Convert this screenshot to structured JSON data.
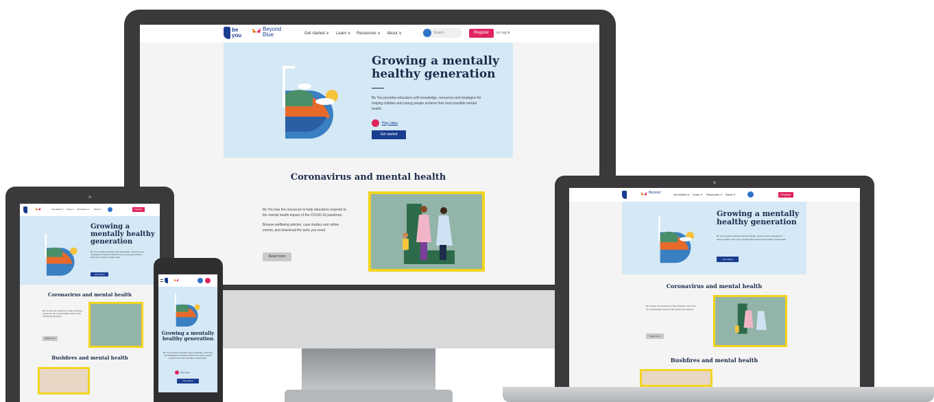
{
  "brand": {
    "be": "be",
    "you": "you",
    "beyond": "Beyond",
    "blue": "Blue",
    "b_letter": "b",
    "butterfly": "butterfly-icon"
  },
  "nav": {
    "items": [
      "Get started ∨",
      "Learn ∨",
      "Resources ∨",
      "About ∨"
    ],
    "search_placeholder": "Search",
    "register": "Register",
    "login": "Log in",
    "or": "or"
  },
  "hero": {
    "title": "Growing a mentally healthy generation",
    "title_l1": "Growing a mentally",
    "title_l2": "healthy generation",
    "title_tab_l1": "Growing a",
    "title_tab_l2": "mentally healthy",
    "title_tab_l3": "generation",
    "body": "Be You provides educators with knowledge, resources and strategies for helping children and young people achieve their best possible mental health.",
    "play_label": "Play video",
    "cta": "Get started"
  },
  "covid": {
    "title": "Coronavirus and mental health",
    "p1": "Be You has the resources to help educators respond to the mental health impact of the COVID-19 pandemic.",
    "p2": "Browse wellbeing articles, case studies and online events, and download the tools you need.",
    "cta": "Read more"
  },
  "bushfires": {
    "title": "Bushfires and mental health"
  },
  "colors": {
    "hero_bg": "#d4e8f5",
    "navy": "#1d2b4a",
    "cta_blue": "#1a3d8f",
    "accent_red": "#e0245e",
    "device_frame": "#3a3a3c",
    "image_border": "#f2d41f"
  }
}
